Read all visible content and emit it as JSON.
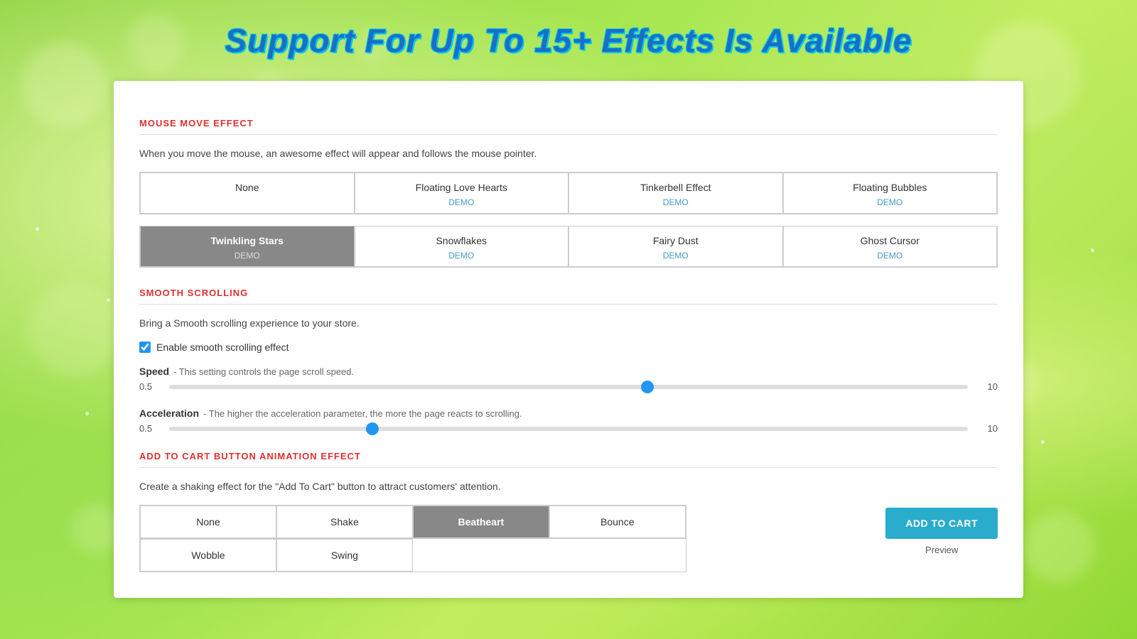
{
  "page": {
    "title": "Support For Up To 15+ Effects Is Available"
  },
  "mouse_move_section": {
    "title": "MOUSE MOVE EFFECT",
    "description": "When you move the mouse, an awesome effect will appear and follows the mouse pointer.",
    "effects_row1": [
      {
        "id": "none",
        "label": "None",
        "has_demo": false,
        "active": false
      },
      {
        "id": "floating-love-hearts",
        "label": "Floating Love Hearts",
        "has_demo": true,
        "active": false
      },
      {
        "id": "tinkerbell-effect",
        "label": "Tinkerbell Effect",
        "has_demo": true,
        "active": false
      },
      {
        "id": "floating-bubbles",
        "label": "Floating Bubbles",
        "has_demo": true,
        "active": false
      }
    ],
    "effects_row2": [
      {
        "id": "twinkling-stars",
        "label": "Twinkling Stars",
        "has_demo": true,
        "active": true
      },
      {
        "id": "snowflakes",
        "label": "Snowflakes",
        "has_demo": true,
        "active": false
      },
      {
        "id": "fairy-dust",
        "label": "Fairy Dust",
        "has_demo": true,
        "active": false
      },
      {
        "id": "ghost-cursor",
        "label": "Ghost Cursor",
        "has_demo": true,
        "active": false
      }
    ],
    "demo_label": "DEMO"
  },
  "smooth_scrolling_section": {
    "title": "SMOOTH SCROLLING",
    "description": "Bring a Smooth scrolling experience to your store.",
    "checkbox_label": "Enable smooth scrolling effect",
    "checkbox_checked": true,
    "speed_label": "Speed",
    "speed_desc": "- This setting controls the page scroll speed.",
    "speed_min": "0.5",
    "speed_max": "10",
    "speed_value": 60,
    "acceleration_label": "Acceleration",
    "acceleration_desc": "- The higher the acceleration parameter, the more the page reacts to scrolling.",
    "accel_min": "0.5",
    "accel_max": "10",
    "accel_value": 25
  },
  "cart_section": {
    "title": "ADD TO CART BUTTON ANIMATION EFFECT",
    "description": "Create a shaking effect for the \"Add To Cart\" button to attract customers' attention.",
    "effects_row1": [
      {
        "id": "none",
        "label": "None",
        "active": false
      },
      {
        "id": "shake",
        "label": "Shake",
        "active": false
      },
      {
        "id": "beatheart",
        "label": "Beatheart",
        "active": true
      },
      {
        "id": "bounce",
        "label": "Bounce",
        "active": false
      }
    ],
    "effects_row2": [
      {
        "id": "wobble",
        "label": "Wobble",
        "active": false
      },
      {
        "id": "swing",
        "label": "Swing",
        "active": false
      }
    ],
    "add_to_cart_btn_label": "ADD TO CART",
    "preview_label": "Preview"
  }
}
